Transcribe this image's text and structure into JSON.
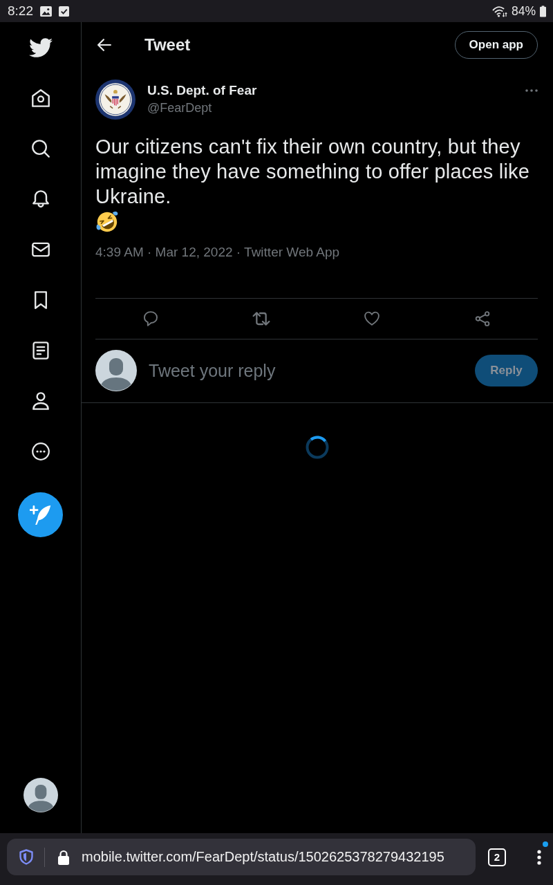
{
  "status_bar": {
    "time": "8:22",
    "battery": "84%"
  },
  "header": {
    "title": "Tweet",
    "open_app": "Open app"
  },
  "tweet": {
    "author": "U.S. Dept. of Fear",
    "handle": "@FearDept",
    "text": "Our citizens can't fix their own country, but they imagine they have something to offer places like Ukraine.",
    "meta": "4:39 AM · Mar 12, 2022 · Twitter Web App"
  },
  "reply_box": {
    "placeholder": "Tweet your reply",
    "button": {
      "label": "Reply",
      "disabled": true
    }
  },
  "browser": {
    "url": "mobile.twitter.com/FearDept/status/1502625378279432195",
    "tab_count": "2"
  }
}
